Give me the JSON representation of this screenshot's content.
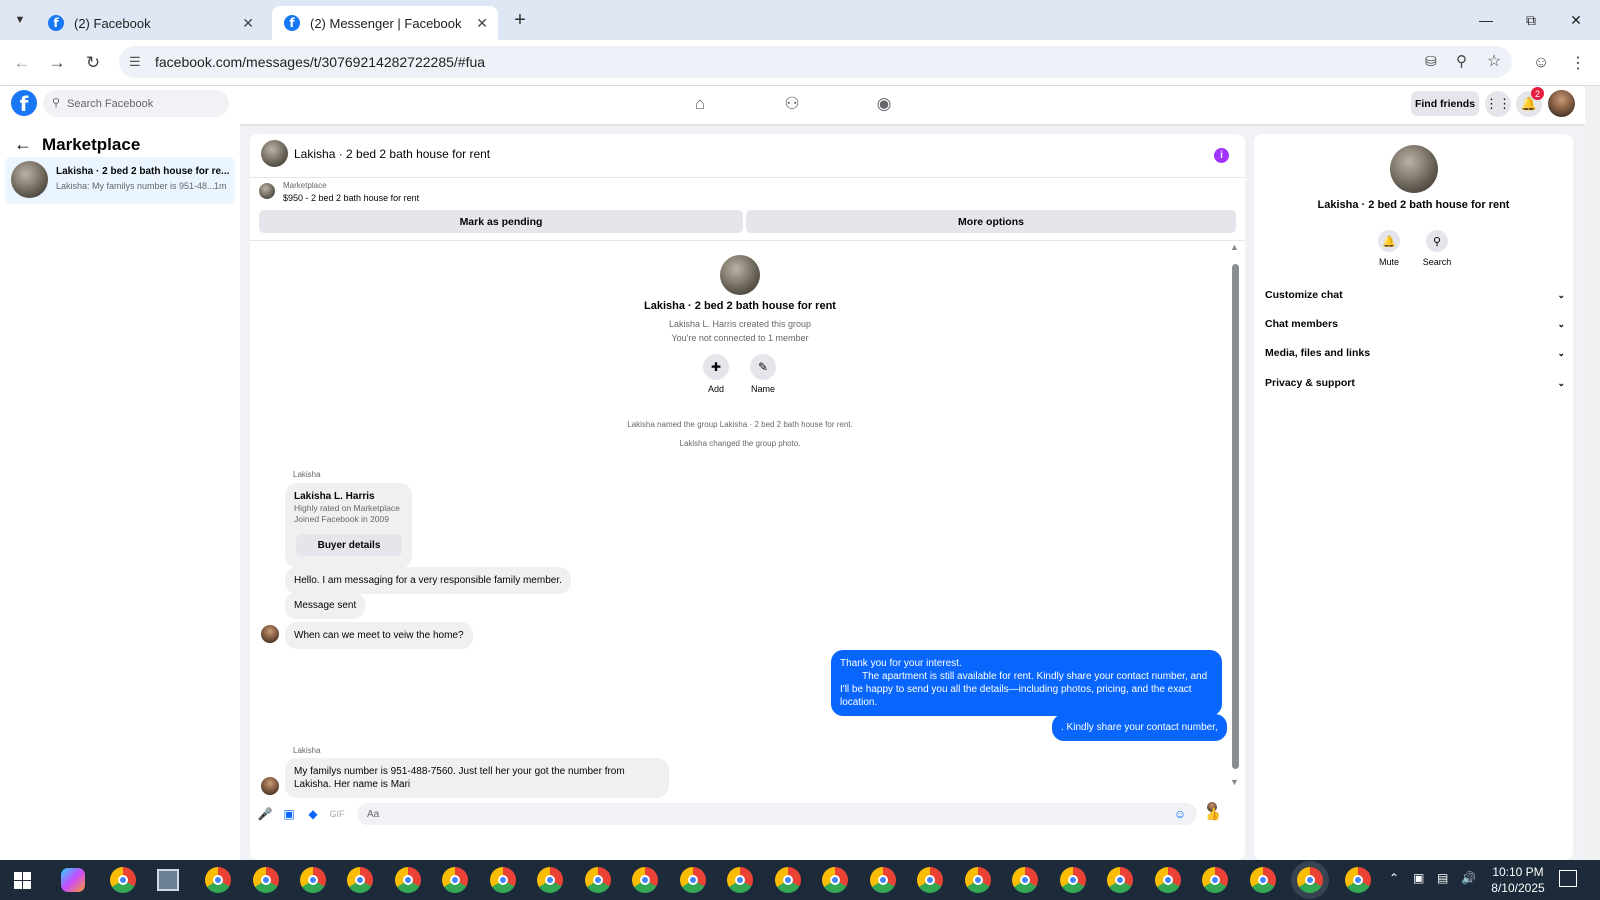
{
  "browser": {
    "tabs": [
      {
        "label": "(2) Facebook",
        "active": false
      },
      {
        "label": "(2) Messenger | Facebook",
        "active": true
      }
    ],
    "url": "facebook.com/messages/t/30769214282722285/#fua"
  },
  "fb_nav": {
    "search_placeholder": "Search Facebook",
    "find_friends": "Find friends",
    "notification_count": "2"
  },
  "left": {
    "title": "Marketplace",
    "conversation": {
      "title": "Lakisha · 2 bed 2 bath house for re...",
      "preview": "Lakisha: My familys number is 951-48...",
      "time": "1m"
    }
  },
  "chat": {
    "header_title": "Lakisha · 2 bed 2 bath house for rent",
    "marketplace_label": "Marketplace",
    "listing": "$950 - 2 bed 2 bath house for rent",
    "mark_pending": "Mark as pending",
    "more_options": "More options",
    "group_name": "Lakisha · 2 bed 2 bath house for rent",
    "created_by": "Lakisha L. Harris created this group",
    "not_connected": "You're not connected to 1 member",
    "add_label": "Add",
    "name_label": "Name",
    "event1": "Lakisha named the group Lakisha · 2 bed 2 bath house for rent.",
    "event2": "Lakisha changed the group photo.",
    "sender1": "Lakisha",
    "card_name": "Lakisha L. Harris",
    "card_line1": "Highly rated on Marketplace",
    "card_line2": "Joined Facebook in 2009",
    "buyer_details": "Buyer details",
    "msg1": "Hello. I am messaging for a very responsible family member.",
    "msg2": "Message sent",
    "msg3": "When can we meet to veiw the home?",
    "my_msg1_line1": "Thank you for your interest.",
    "my_msg1_line2": "The apartment is still available for rent. Kindly share your contact number, and I'll be happy to send you all the details—including photos, pricing, and the exact location.",
    "my_msg2": ". Kindly share your contact number,",
    "sender2": "Lakisha",
    "msg4": "My familys number is 951-488-7560. Just tell her your got the number from Lakisha. Her name is Mari",
    "composer_placeholder": "Aa"
  },
  "right": {
    "title": "Lakisha · 2 bed 2 bath house for rent",
    "mute": "Mute",
    "search": "Search",
    "sections": [
      "Customize chat",
      "Chat members",
      "Media, files and links",
      "Privacy & support"
    ]
  },
  "taskbar": {
    "time": "10:10 PM",
    "date": "8/10/2025"
  },
  "icons": [
    "chevron-down-icon",
    "facebook-icon",
    "close-icon",
    "plus-icon",
    "minimize-icon",
    "restore-icon",
    "back-icon",
    "forward-icon",
    "reload-icon",
    "site-settings-icon",
    "install-icon",
    "zoom-icon",
    "star-icon",
    "profile-icon",
    "menu-icon",
    "search-icon",
    "home-icon",
    "friends-icon",
    "groups-icon",
    "apps-grid-icon",
    "bell-icon",
    "back-arrow-icon",
    "info-icon",
    "add-person-icon",
    "pencil-icon",
    "microphone-icon",
    "image-icon",
    "sticker-icon",
    "gif-icon",
    "emoji-icon",
    "thumbs-up-icon"
  ]
}
